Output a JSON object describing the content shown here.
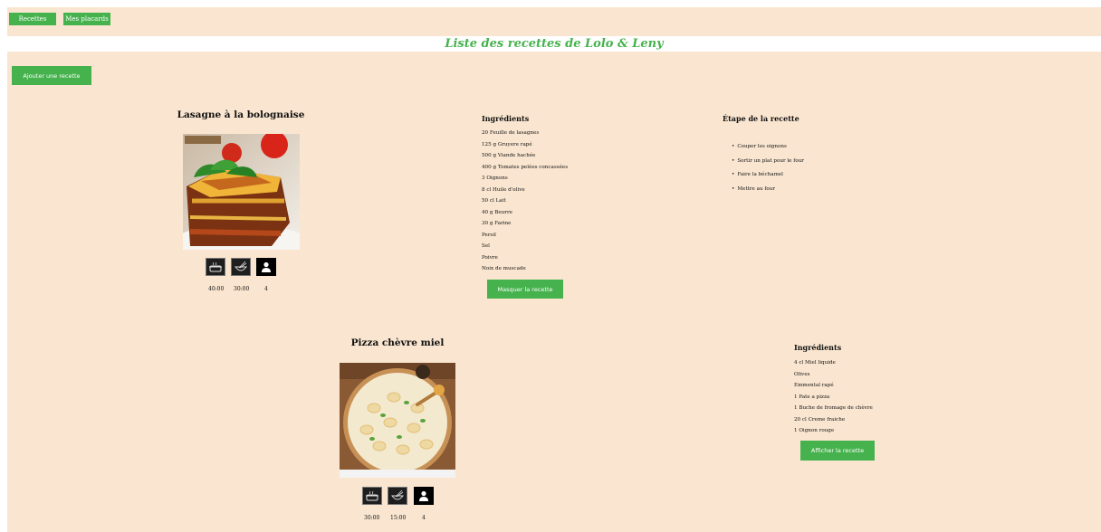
{
  "nav": {
    "recettes_label": "Recettes",
    "placards_label": "Mes placards"
  },
  "page_title": "Liste des recettes de Lolo & Leny",
  "add_recipe_label": "Ajouter une recette",
  "colors": {
    "accent": "#46b24d",
    "background": "#fae6d0",
    "title": "#46b24d"
  },
  "recipes": [
    {
      "name": "Lasagne à la bolognaise",
      "image": "lasagna-photo",
      "icons": [
        "cooking-pot-icon",
        "whisk-bowl-icon",
        "person-icon"
      ],
      "cook_time": "40:00",
      "prep_time": "30:00",
      "servings": "4",
      "ingredients_title": "Ingrédients",
      "ingredients": [
        "20 Feuille de lasagnes",
        "125 g Gruyere rapé",
        "500 g Viande hachée",
        "400 g Tomates pelées concassées",
        "3 Oignons",
        "8 cl Huile d'olive",
        "50 cl Lait",
        "40 g Beurre",
        "30 g Farine",
        "Persil",
        "Sel",
        "Poivre",
        "Noix de muscade"
      ],
      "toggle_label": "Masquer la recette",
      "steps_title": "Étape de la recette",
      "steps": [
        "Couper les oignons",
        "Sortir un plat pour le four",
        "Faire la béchamel",
        "Mettre au four"
      ]
    },
    {
      "name": "Pizza chèvre miel",
      "image": "pizza-photo",
      "icons": [
        "cooking-pot-icon",
        "whisk-bowl-icon",
        "person-icon"
      ],
      "cook_time": "30:00",
      "prep_time": "15:00",
      "servings": "4",
      "ingredients_title": "Ingrédients",
      "ingredients": [
        "4 cl Miel liquide",
        "Olives",
        "Emmental rapé",
        "1 Pate a pizza",
        "1 Buche de fromage de chèvre",
        "20 cl Creme fraiche",
        "1 Oignon rouge"
      ],
      "toggle_label": "Afficher la recette"
    }
  ]
}
